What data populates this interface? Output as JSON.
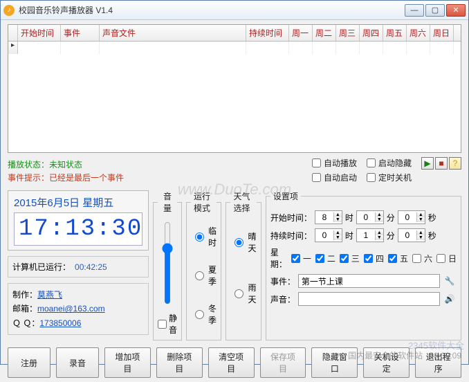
{
  "window": {
    "title": "校园音乐铃声播放器 V1.4"
  },
  "titlebar_icon_glyph": "♪",
  "grid": {
    "headers": [
      "开始时间",
      "事件",
      "声音文件",
      "持续时间",
      "周一",
      "周二",
      "周三",
      "周四",
      "周五",
      "周六",
      "周日"
    ],
    "row_marker": "▸"
  },
  "status": {
    "play_label": "播放状态：",
    "play_value": "未知状态",
    "event_label": "事件提示：",
    "event_value": "已经是最后一个事件"
  },
  "options": {
    "auto_play": "自动播放",
    "start_hidden": "启动隐藏",
    "auto_start": "自动启动",
    "timed_shutdown": "定时关机"
  },
  "icon_buttons": {
    "play": "▶",
    "stop": "■",
    "help": "?"
  },
  "left": {
    "date": "2015年6月5日  星期五",
    "clock": "17:13:30",
    "uptime_label": "计算机已运行：",
    "uptime_value": "00:42:25",
    "author_label": "制作：",
    "author_value": "莫燕飞",
    "mail_label": "邮箱：",
    "mail_value": "moanei@163.com",
    "qq_label": "Ｑ Ｑ：",
    "qq_value": "173850006"
  },
  "volume": {
    "legend": "音量",
    "mute": "静音",
    "value": 70
  },
  "mode": {
    "legend": "运行模式",
    "items": [
      "临时",
      "夏季",
      "冬季"
    ],
    "selected": 0
  },
  "weather": {
    "legend": "天气选择",
    "items": [
      "晴天",
      "雨天"
    ],
    "selected": 0
  },
  "settings": {
    "legend": "设置项",
    "start_label": "开始时间：",
    "dur_label": "持续时间：",
    "h_unit": "时",
    "m_unit": "分",
    "s_unit": "秒",
    "start_h": "8",
    "start_m": "0",
    "start_s": "0",
    "dur_h": "0",
    "dur_m": "1",
    "dur_s": "0",
    "week_label": "星期：",
    "days": [
      "一",
      "二",
      "三",
      "四",
      "五",
      "六",
      "日"
    ],
    "days_checked": [
      true,
      true,
      true,
      true,
      true,
      false,
      false
    ],
    "event_label": "事件：",
    "event_value": "第一节上课",
    "sound_label": "声音：",
    "sound_value": ""
  },
  "buttons": {
    "register": "注册",
    "record": "录音",
    "add": "增加项目",
    "del": "删除项目",
    "clear": "清空项目",
    "save": "保存项目",
    "hide": "隐藏窗口",
    "shutdown": "关机设定",
    "exit": "退出程序"
  },
  "watermark": "www.DuoTe.com",
  "corner": {
    "brand": "2345软件大全",
    "slogan": "国内最安全的软件站",
    "time": "00:00:09"
  }
}
